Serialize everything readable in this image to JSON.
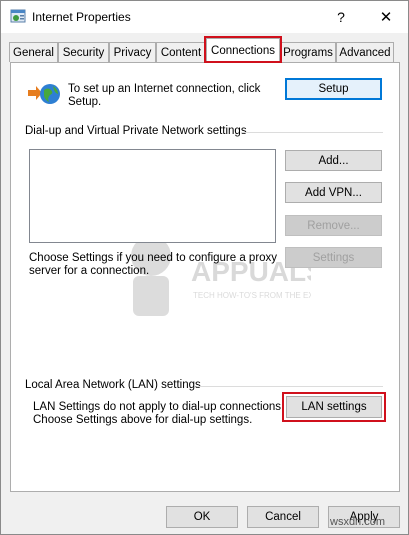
{
  "window": {
    "title": "Internet Properties",
    "help_glyph": "?",
    "close_glyph": "✕"
  },
  "tabs": [
    {
      "label": "General"
    },
    {
      "label": "Security"
    },
    {
      "label": "Privacy"
    },
    {
      "label": "Content"
    },
    {
      "label": "Connections",
      "active": true
    },
    {
      "label": "Programs"
    },
    {
      "label": "Advanced"
    }
  ],
  "setup": {
    "description_line1": "To set up an Internet connection, click",
    "description_line2": "Setup.",
    "button": "Setup"
  },
  "dialup": {
    "heading": "Dial-up and Virtual Private Network settings",
    "add_button": "Add...",
    "add_vpn_button": "Add VPN...",
    "remove_button": "Remove...",
    "settings_button": "Settings",
    "hint_line1": "Choose Settings if you need to configure a proxy",
    "hint_line2": "server for a connection."
  },
  "lan": {
    "heading": "Local Area Network (LAN) settings",
    "line1": "LAN Settings do not apply to dial-up connections.",
    "line2": "Choose Settings above for dial-up settings.",
    "button": "LAN settings"
  },
  "footer": {
    "ok": "OK",
    "cancel": "Cancel",
    "apply": "Apply"
  },
  "watermark": {
    "brand": "APPUALS",
    "tagline": "TECH HOW-TO'S FROM THE EXPERTS!"
  },
  "source_url": "wsxdn.com",
  "colors": {
    "highlight": "#d0101c",
    "accent": "#0078d7"
  }
}
